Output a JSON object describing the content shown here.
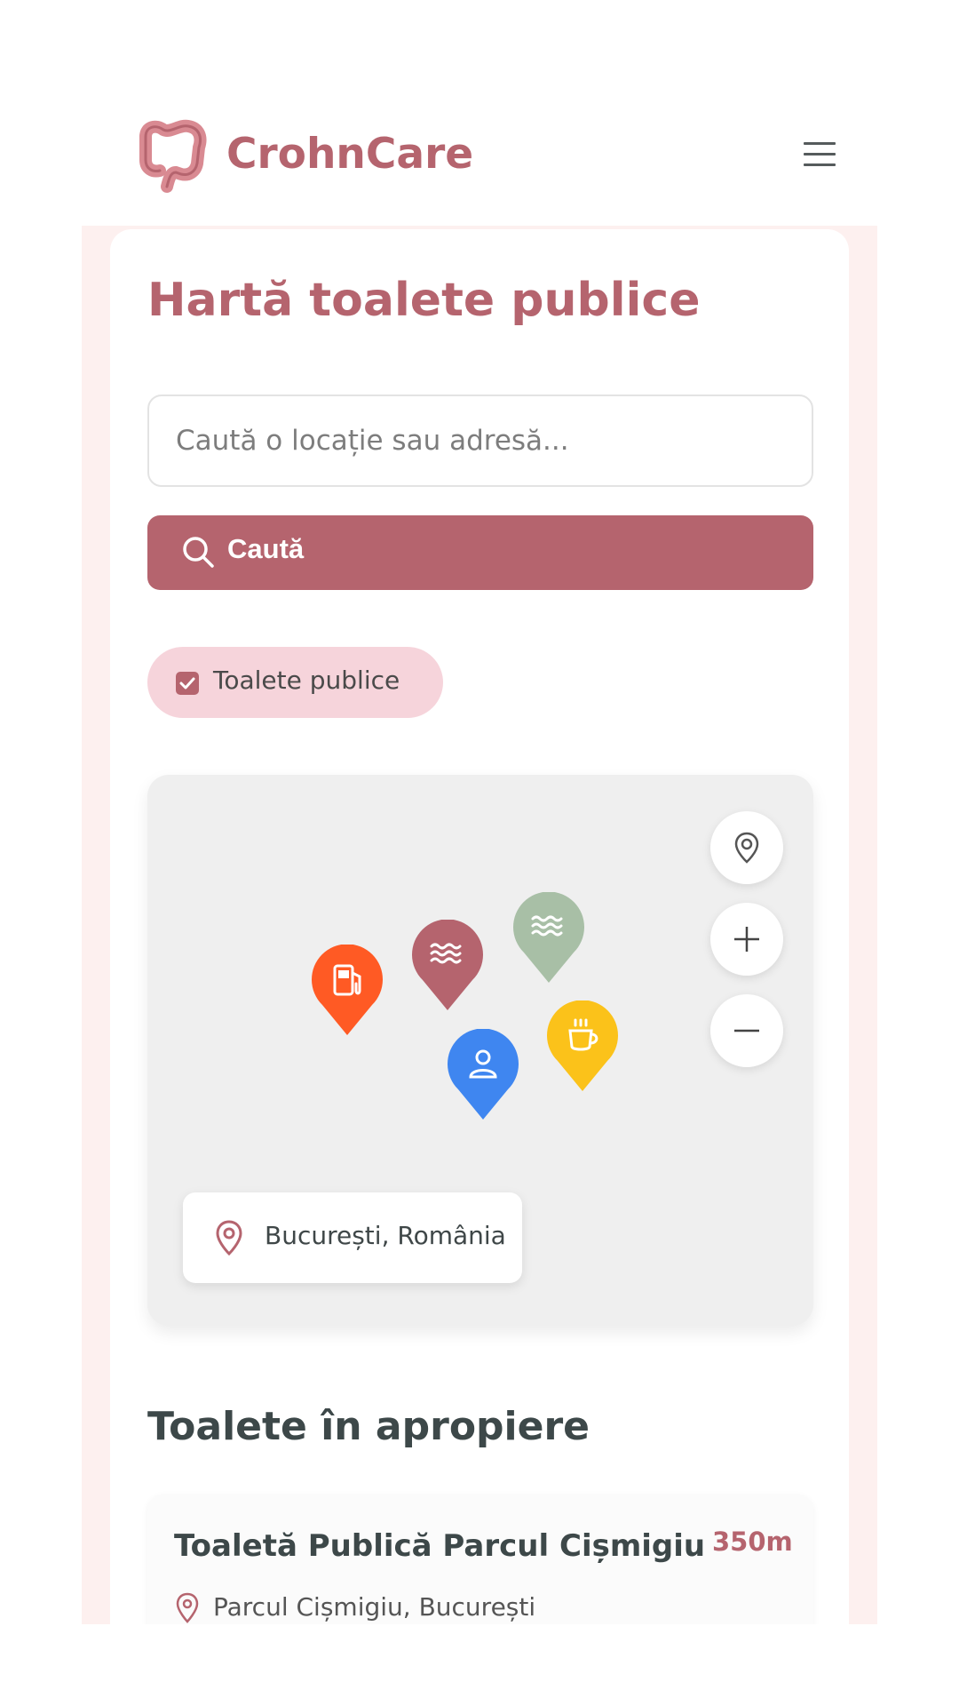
{
  "app": {
    "name": "CrohnCare",
    "brand_color": "#b5646e",
    "logo_icon": "intestine-icon",
    "menu_icon": "hamburger-menu-icon"
  },
  "page": {
    "title": "Hartă toalete publice"
  },
  "search": {
    "placeholder": "Caută o locație sau adresă...",
    "value": "",
    "button_label": "Caută",
    "button_icon": "search-icon"
  },
  "filters": [
    {
      "label": "Toalete publice",
      "checked": true
    }
  ],
  "map": {
    "location_label": "București, România",
    "controls": [
      "my-location-icon",
      "zoom-in-icon",
      "zoom-out-icon"
    ],
    "markers": [
      {
        "icon": "fuel-pump-icon",
        "color": "#ff5a24"
      },
      {
        "icon": "waves-icon",
        "color": "#b5646e"
      },
      {
        "icon": "waves-icon",
        "color": "#a8bfa6"
      },
      {
        "icon": "person-icon",
        "color": "#3f86f0"
      },
      {
        "icon": "coffee-cup-icon",
        "color": "#fbc21a"
      }
    ]
  },
  "nearby": {
    "title": "Toalete în apropiere",
    "items": [
      {
        "name": "Toaletă Publică Parcul Cișmigiu",
        "distance": "350m",
        "address": "Parcul Cișmigiu, București"
      }
    ]
  }
}
